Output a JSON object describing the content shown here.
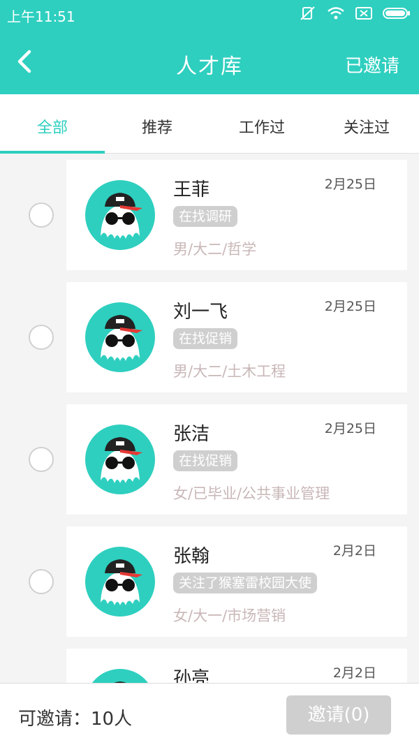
{
  "status_bar": {
    "time": "上午11:51",
    "icons": [
      "mute-icon",
      "wifi-icon",
      "sim-icon",
      "battery-icon"
    ]
  },
  "header": {
    "title": "人才库",
    "invited_label": "已邀请"
  },
  "tabs": [
    {
      "label": "全部",
      "active": true
    },
    {
      "label": "推荐",
      "active": false
    },
    {
      "label": "工作过",
      "active": false
    },
    {
      "label": "关注过",
      "active": false
    }
  ],
  "candidates": [
    {
      "name": "王菲",
      "date": "2月25日",
      "tag": "在找调研",
      "info": "男/大二/哲学"
    },
    {
      "name": "刘一飞",
      "date": "2月25日",
      "tag": "在找促销",
      "info": "男/大二/土木工程"
    },
    {
      "name": "张洁",
      "date": "2月25日",
      "tag": "在找促销",
      "info": "女/已毕业/公共事业管理"
    },
    {
      "name": "张翰",
      "date": "2月2日",
      "tag": "关注了猴塞雷校园大使",
      "info": "女/大一/市场营销"
    },
    {
      "name": "孙亮",
      "date": "2月2日",
      "tag": "",
      "info": ""
    }
  ],
  "footer": {
    "quota_label": "可邀请：10人",
    "invite_button": "邀请(0)"
  },
  "colors": {
    "accent": "#2ecfbf",
    "tag_bg": "#cfcfcf",
    "info_text": "#c9b7b7",
    "button_disabled": "#cfcfcf"
  }
}
